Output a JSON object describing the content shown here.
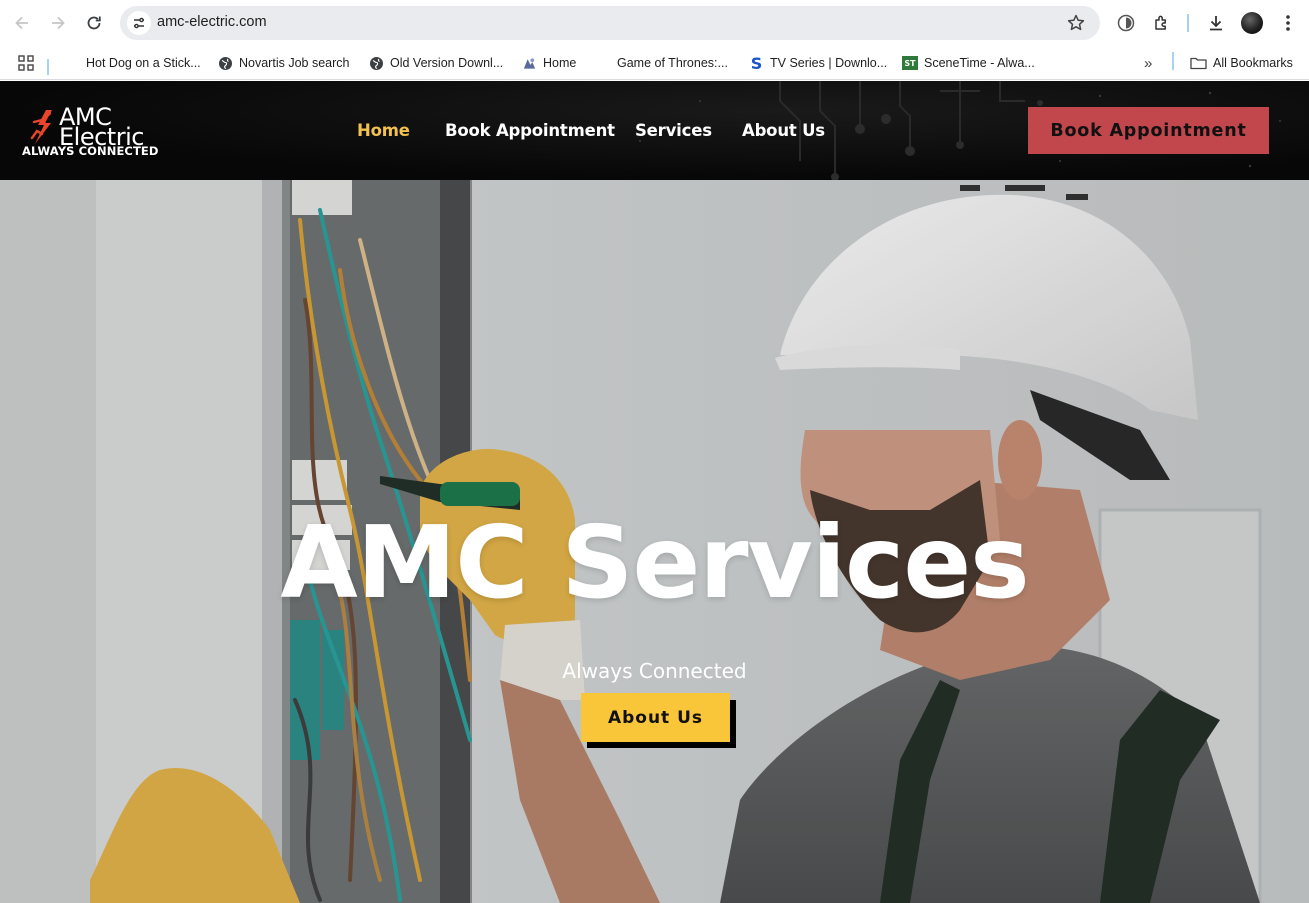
{
  "browser": {
    "url": "amc-electric.com",
    "bookmarks": [
      {
        "label": "Hot Dog on a Stick...",
        "icon": "none"
      },
      {
        "label": "Novartis Job search",
        "icon": "globe-icon"
      },
      {
        "label": "Old Version Downl...",
        "icon": "globe-icon"
      },
      {
        "label": "Home",
        "icon": "site-favicon"
      },
      {
        "label": "Game of Thrones:...",
        "icon": "none"
      },
      {
        "label": "TV Series | Downlo...",
        "icon": "s-favicon"
      },
      {
        "label": "SceneTime - Alwa...",
        "icon": "st-favicon"
      }
    ],
    "overflow_label": "»",
    "all_bookmarks_label": "All Bookmarks"
  },
  "site": {
    "logo": {
      "line1": "AMC",
      "line2": "Electric",
      "tagline": "ALWAYS CONNECTED"
    },
    "nav": [
      {
        "label": "Home",
        "active": true
      },
      {
        "label": "Book Appointment",
        "active": false
      },
      {
        "label": "Services",
        "active": false
      },
      {
        "label": "About Us",
        "active": false
      }
    ],
    "cta_label": "Book Appointment",
    "colors": {
      "header_bg": "#0b0b0b",
      "nav_active": "#f2c14e",
      "cta_bg": "#c1474c",
      "hero_button_bg": "#f9c63a"
    }
  },
  "hero": {
    "title": "AMC Services",
    "subtitle": "Always Connected",
    "button_label": "About Us"
  }
}
